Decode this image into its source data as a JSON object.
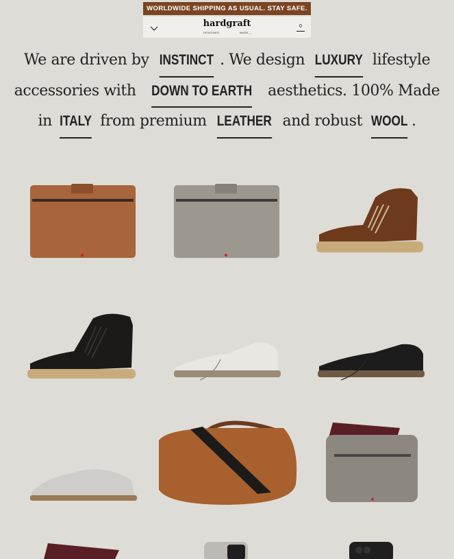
{
  "banner": {
    "text": "WORLDWIDE SHIPPING AS USUAL. STAY SAFE."
  },
  "nav": {
    "logo": "hardgraft",
    "tag_left": "DESIGNED",
    "tag_right": "MADE__",
    "cart_count": "0"
  },
  "intro": {
    "l1a": "We are driven by ",
    "k1": "INSTINCT",
    "l1b": ". We design ",
    "k2": "LUXURY",
    "l1c": " lifestyle accessories with ",
    "k3": "DOWN TO EARTH",
    "l1d": " aesthetics. 100% Made in ",
    "k4": "ITALY",
    "l1e": " from premium ",
    "k5": "LEATHER",
    "l1f": " and robust ",
    "k6": "WOOL",
    "l1g": "."
  },
  "products": [
    {
      "name": "tan leather zip laptop case",
      "icon": "tan-laptop-case"
    },
    {
      "name": "grey leather zip laptop case",
      "icon": "grey-laptop-case"
    },
    {
      "name": "brown leather lace-up boot",
      "icon": "brown-boot"
    },
    {
      "name": "black leather lace-up boot",
      "icon": "black-boot"
    },
    {
      "name": "white leather low shoe",
      "icon": "white-shoe"
    },
    {
      "name": "black suede low shoe",
      "icon": "black-shoe"
    },
    {
      "name": "grey felt wool slipper",
      "icon": "felt-slipper"
    },
    {
      "name": "tan leather weekender bag",
      "icon": "tan-weekender-bag"
    },
    {
      "name": "grey leather travel wallet",
      "icon": "grey-travel-wallet"
    },
    {
      "name": "passport holder",
      "icon": "passport-holder"
    },
    {
      "name": "grey felt phone case",
      "icon": "felt-phone-case"
    },
    {
      "name": "black phone case",
      "icon": "black-phone-case"
    }
  ]
}
